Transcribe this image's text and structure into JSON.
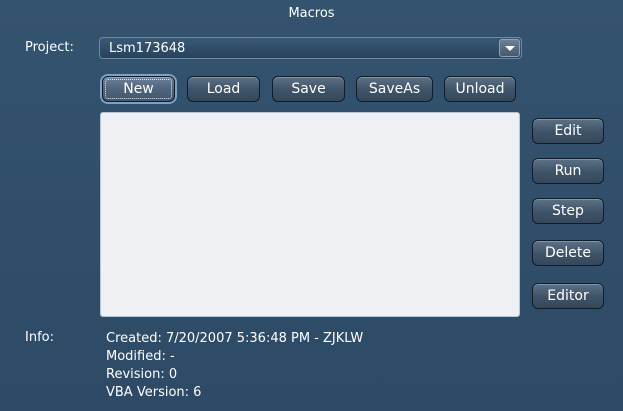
{
  "window": {
    "title": "Macros"
  },
  "project": {
    "label": "Project:",
    "selected": "Lsm173648"
  },
  "toolbar": {
    "new_label": "New",
    "load_label": "Load",
    "save_label": "Save",
    "saveas_label": "SaveAs",
    "unload_label": "Unload"
  },
  "side_buttons": {
    "edit_label": "Edit",
    "run_label": "Run",
    "step_label": "Step",
    "delete_label": "Delete",
    "editor_label": "Editor"
  },
  "info": {
    "label": "Info:",
    "created": "Created: 7/20/2007 5:36:48 PM - ZJKLW",
    "modified": "Modified:  -",
    "revision": "Revision: 0",
    "vba_version": "VBA Version: 6"
  },
  "macro_list": {
    "items": []
  },
  "colors": {
    "background": "#2f4d6a",
    "list_background": "#eef0f3",
    "accent": "#7ea3c8"
  },
  "icons": {
    "combo_arrow": "chevron-down-icon"
  }
}
